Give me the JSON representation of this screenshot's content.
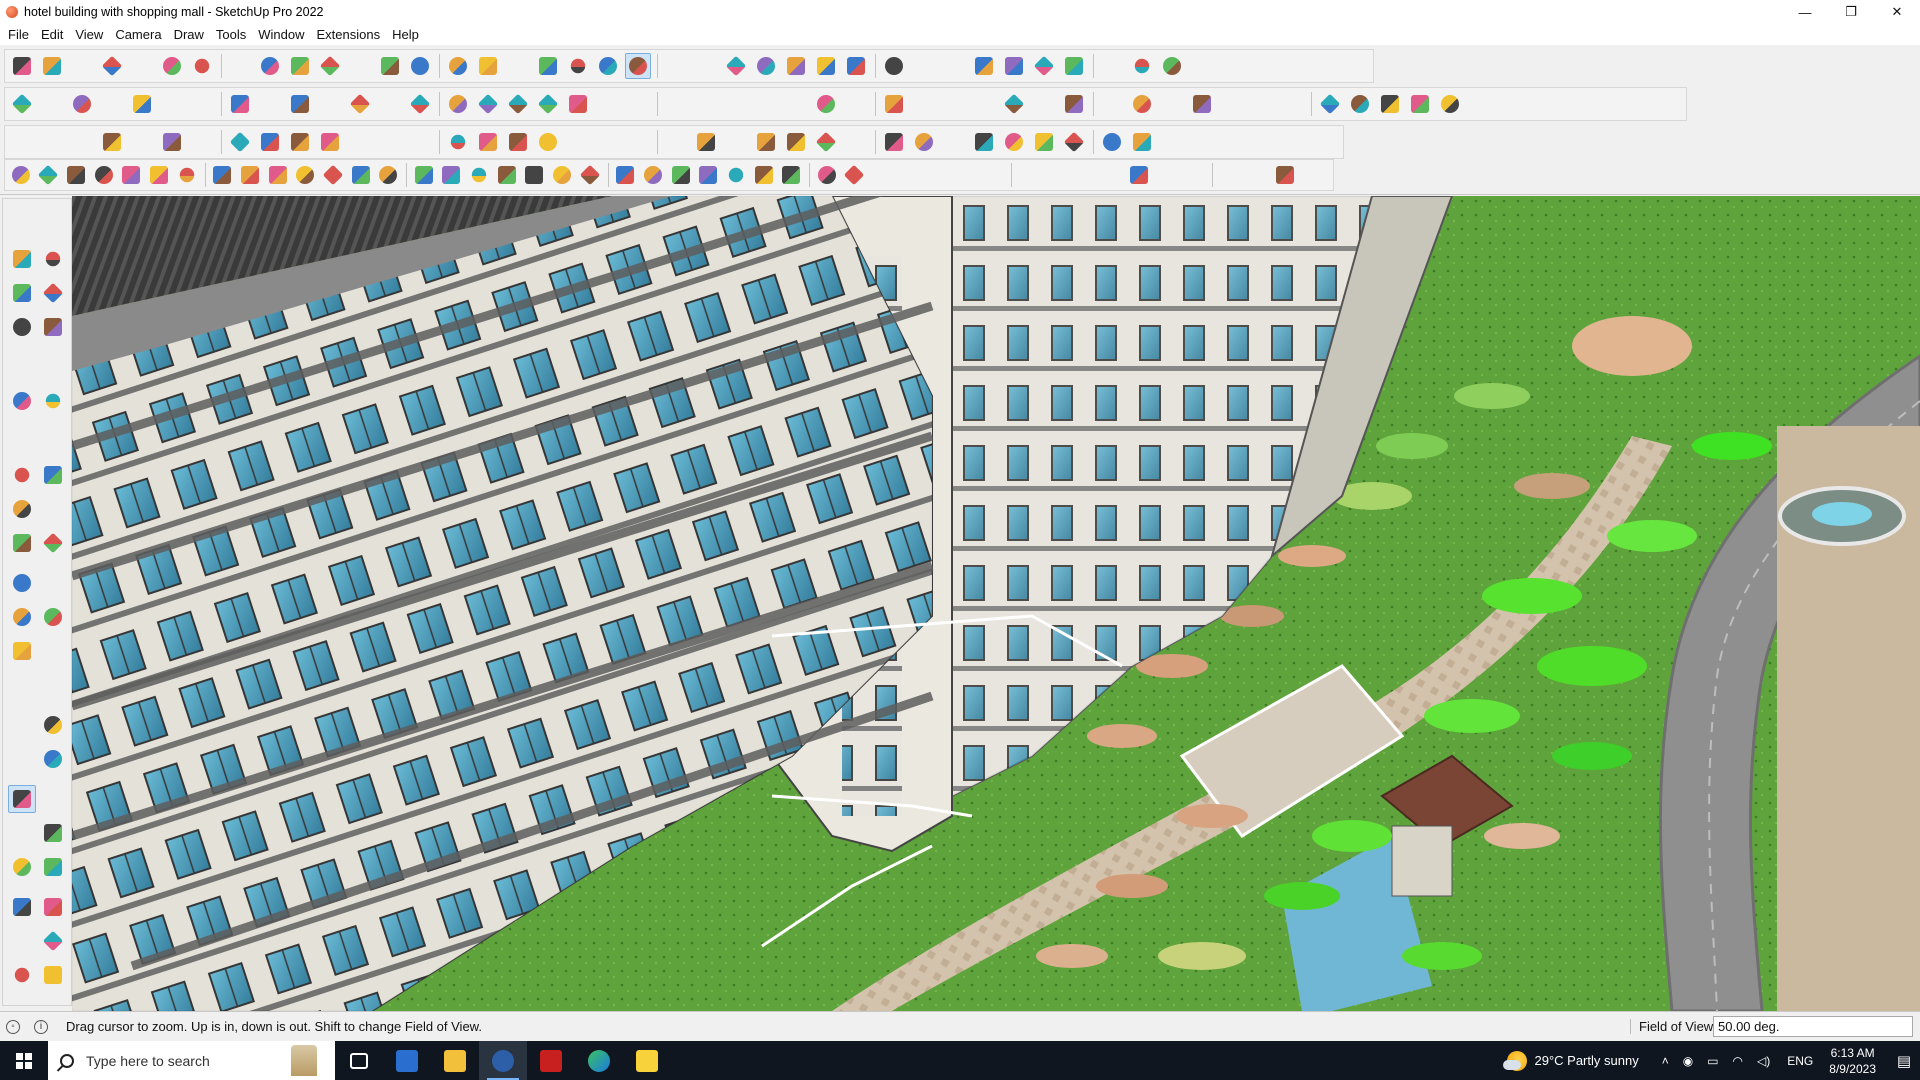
{
  "window": {
    "title": "hotel building with shopping mall - SketchUp Pro 2022",
    "controls": {
      "minimize": "—",
      "restore": "❐",
      "close": "✕"
    }
  },
  "menu": [
    "File",
    "Edit",
    "View",
    "Camera",
    "Draw",
    "Tools",
    "Window",
    "Extensions",
    "Help"
  ],
  "toolbars": {
    "row1_icons": [
      "zoom-icon",
      "select-icon",
      "select-dropdown-icon",
      "eraser-icon",
      "pencil-icon",
      "line-dropdown-icon",
      "arc-icon",
      "arc-dropdown-icon",
      "rectangle-icon",
      "rectangle-dropdown-icon",
      "push-pull-icon",
      "follow-me-icon",
      "move-icon",
      "rotate-icon",
      "scale-icon",
      "tape-measure-icon",
      "text-icon",
      "paint-bucket-icon",
      "orbit-icon",
      "pan-icon",
      "zoom-active-icon",
      "zoom-extents-icon",
      "warehouse-icon",
      "extension-warehouse-icon",
      "layout-icon",
      "trimble-connect-icon",
      "account-icon",
      "account-dropdown-icon",
      "component-icon",
      "material-icon",
      "axes-icon",
      "sandbox-up-icon",
      "sandbox-down-icon",
      "section-icon",
      "solid-icon",
      "undo-icon",
      "redo-icon",
      "help-icon"
    ],
    "row2_icons": [
      "cube-iso-icon",
      "cube-xray-icon",
      "cube-hidden-icon",
      "push-icon",
      "view-top-icon",
      "view-front-icon",
      "view-right-icon",
      "view-back-icon",
      "view-left-icon",
      "view-bottom-icon",
      "view-iso-icon",
      "view-persp-icon",
      "shadow-icon",
      "style-wire-icon",
      "style-hidden-icon",
      "style-shaded-icon",
      "sandbox-smoove-icon",
      "sandbox-stamp-icon",
      "house-1-icon",
      "house-2-icon",
      "house-3-icon",
      "house-4-icon",
      "house-5-icon",
      "house-6-icon",
      "font-icon",
      "tag-icon",
      "brush-icon",
      "lasso-1-icon",
      "circle-1-icon",
      "polygon-1-icon",
      "ellipse-icon",
      "polygon-2-icon",
      "parallelogram-icon",
      "curve-icon",
      "pan-2-icon",
      "lasso-2-icon",
      "lasso-3-icon",
      "lasso-4-icon",
      "measure-red-icon",
      "eraser-pink-icon",
      "shape-1-icon",
      "shape-2-icon",
      "shape-3-icon",
      "shape-4-icon",
      "shape-5-icon",
      "shape-6-icon",
      "shape-7-icon"
    ],
    "row3_icons": [
      "box-blue-icon",
      "diamond-blue-icon",
      "diamond-yellow-icon",
      "diamond-green-icon",
      "diamond-red-icon",
      "diamond-white-icon",
      "link-icon",
      "arc-orange-icon",
      "square-red-icon",
      "grid-icon",
      "panel-icon",
      "cube-wood-icon",
      "chain-icon",
      "hook-icon",
      "spline-icon",
      "cross-red-icon",
      "cross-green-icon",
      "cross-blue-icon",
      "cone-cyan-icon",
      "cone-teal-icon",
      "triangle-icon",
      "loop-orange-icon",
      "loop-red-icon",
      "loop-blue-icon",
      "star-icon",
      "bucket-icon",
      "undo-red-icon",
      "tree-icon",
      "gear-red-icon",
      "blocks-icon",
      "shape-red-icon",
      "plugin-1-icon",
      "plugin-2-icon",
      "plugin-3-icon",
      "plugin-4-icon",
      "plugin-5-icon",
      "plugin-6-icon",
      "dots-icon",
      "graph-icon"
    ],
    "row4_icons": [
      "tool-1-icon",
      "tool-2-icon",
      "tool-3-icon",
      "tool-4-icon",
      "tool-5-icon",
      "tool-6-icon",
      "tool-7-icon",
      "tool-8-icon",
      "tool-9-icon",
      "tool-10-icon",
      "tool-11-icon",
      "tool-12-icon",
      "tool-13-icon",
      "tool-14-icon",
      "tool-15-icon",
      "tool-16-icon",
      "tool-17-icon",
      "tool-18-icon",
      "tool-19-icon",
      "tool-20-icon",
      "tool-21-icon",
      "tool-22-icon",
      "tool-23-icon",
      "tool-24-icon",
      "tool-25-icon",
      "tool-26-icon",
      "tool-27-icon",
      "tool-28-icon",
      "tool-29-icon",
      "tool-30-icon",
      "tool-31-icon",
      "tool-32-icon",
      "tool-33-icon",
      "tool-34-icon",
      "tool-35-icon",
      "tool-36-icon",
      "tool-37-icon",
      "tool-38-icon",
      "tool-39-icon",
      "tool-40-icon",
      "tool-41-icon",
      "tool-42-icon",
      "tool-43-icon",
      "tool-44-icon",
      "tool-45-icon",
      "tool-46-icon"
    ]
  },
  "left_toolbar_icons": [
    "select-icon",
    "orbit-icon",
    "paint-bucket-icon",
    "eraser-icon",
    "component-icon",
    "tape-icon",
    "pencil-icon",
    "freehand-icon",
    "rectangle-icon",
    "rotated-rectangle-icon",
    "circle-icon",
    "polygon-icon",
    "arc-icon",
    "arc-2-icon",
    "arc-3-icon",
    "pie-icon",
    "move-icon",
    "push-pull-icon",
    "rotate-icon",
    "follow-me-icon",
    "scale-icon",
    "offset-icon",
    "tape-measure-icon",
    "dimension-icon",
    "protractor-icon",
    "text-icon",
    "axes-icon",
    "3d-text-icon",
    "orbit-2-icon",
    "pan-icon",
    "zoom-icon",
    "zoom-window-icon",
    "zoom-extents-icon",
    "previous-view-icon",
    "position-camera-icon",
    "look-around-icon",
    "walk-icon",
    "section-plane-icon",
    "warehouse-icon",
    "extension-warehouse-icon",
    "layers-icon",
    "sandbox-icon"
  ],
  "status": {
    "message": "Drag cursor to zoom.  Up is in, down is out. Shift to change Field of View.",
    "measure_label": "Field of View",
    "measure_value": "50.00 deg."
  },
  "taskbar": {
    "search_placeholder": "Type here to search",
    "apps": [
      "task-view-icon",
      "calculator-icon",
      "file-explorer-icon",
      "sketchup-icon",
      "acrobat-icon",
      "edge-icon",
      "sticky-notes-icon"
    ],
    "weather": "29°C  Partly sunny",
    "language": "ENG",
    "time": "6:13 AM",
    "date": "8/9/2023"
  },
  "colors": {
    "accent": "#cfe3f7",
    "facade": "#e6e3da",
    "glass": "#3d8fb3",
    "lawn": "#5a9e3a",
    "taskbar": "#0f1620"
  }
}
